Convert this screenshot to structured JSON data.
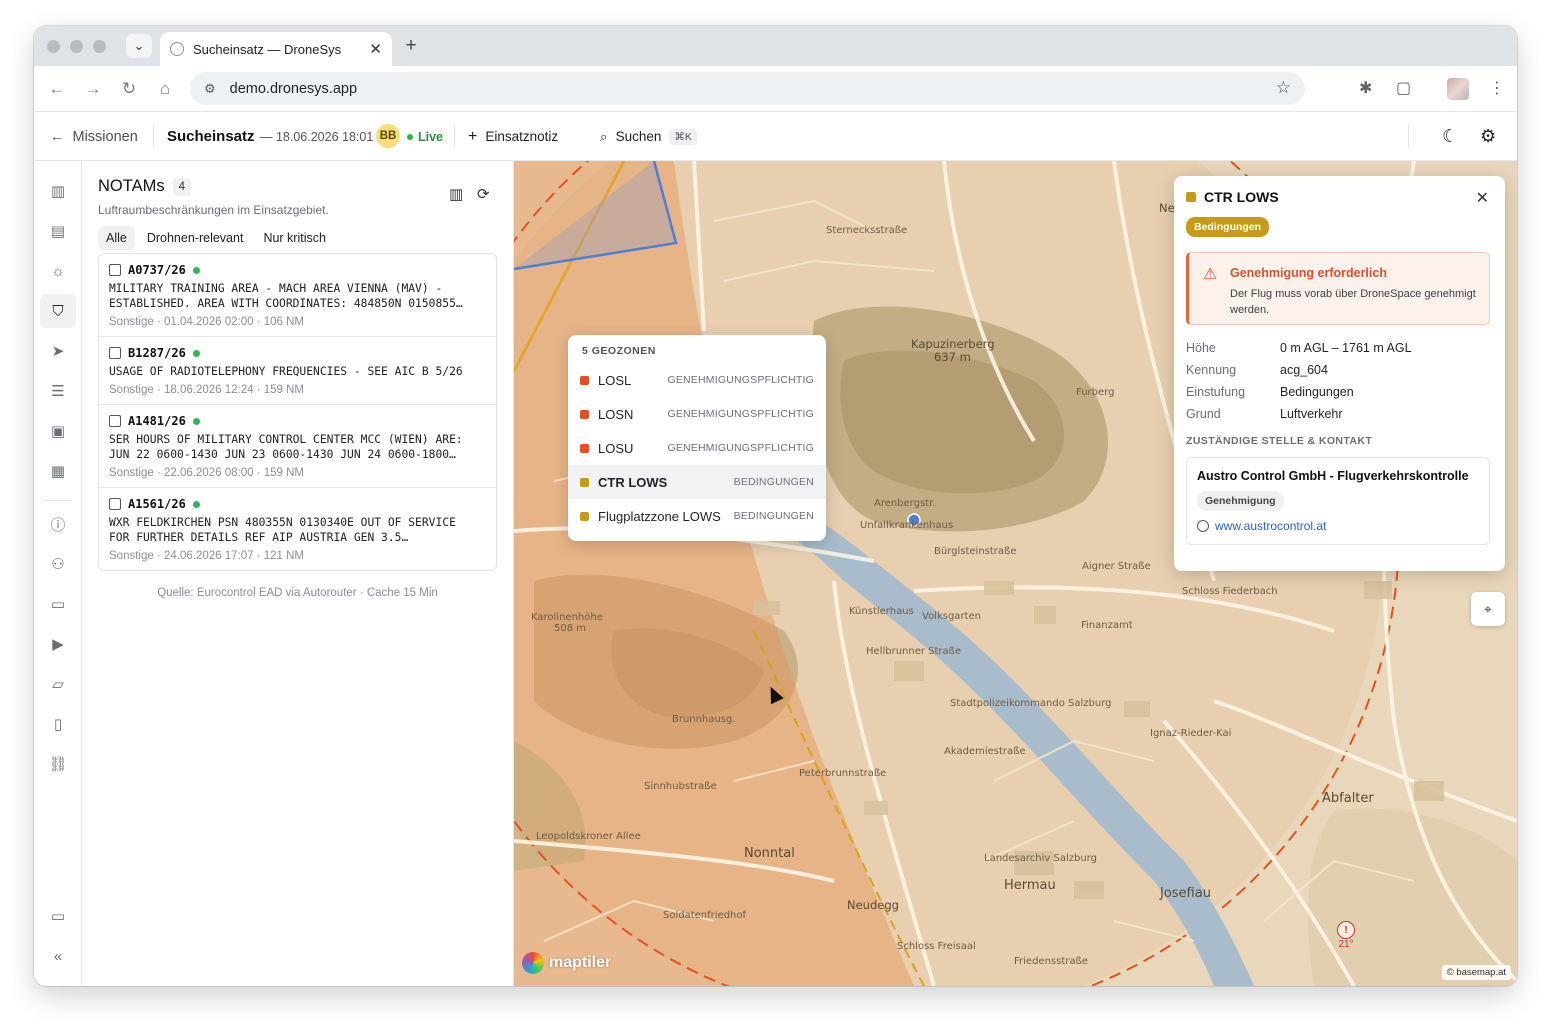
{
  "browser": {
    "tab_title": "Sucheinsatz — DroneSys",
    "url": "demo.dronesys.app",
    "icons": [
      "chevron-down-icon",
      "close-icon",
      "plus-icon",
      "back-icon",
      "forward-icon",
      "reload-icon",
      "home-icon",
      "site-info-icon",
      "star-icon",
      "extension-icon",
      "menu-dots-icon"
    ]
  },
  "header": {
    "back_label": "Missionen",
    "mission": "Sucheinsatz",
    "date": "— 18.06.2026 18:01",
    "user_initials": "BB",
    "live": "Live",
    "note_label": "Einsatznotiz",
    "search_label": "Suchen",
    "search_kbd": "⌘K"
  },
  "notams": {
    "title": "NOTAMs",
    "count": "4",
    "subtitle": "Luftraumbeschränkungen im Einsatzgebiet.",
    "filters": [
      "Alle",
      "Drohnen-relevant",
      "Nur kritisch"
    ],
    "items": [
      {
        "id": "A0737/26",
        "text": "MILITARY TRAINING AREA - MACH AREA VIENNA (MAV) -\nESTABLISHED. AREA WITH COORDINATES: 484850N 0150855…",
        "meta": "Sonstige · 01.04.2026 02:00 · 106 NM"
      },
      {
        "id": "B1287/26",
        "text": "USAGE OF RADIOTELEPHONY FREQUENCIES - SEE AIC B 5/26",
        "meta": "Sonstige · 18.06.2026 12:24 · 159 NM"
      },
      {
        "id": "A1481/26",
        "text": "SER HOURS OF MILITARY CONTROL CENTER MCC (WIEN) ARE:\nJUN 22 0600-1430 JUN 23 0600-1430 JUN 24 0600-1800…",
        "meta": "Sonstige · 22.06.2026 08:00 · 159 NM"
      },
      {
        "id": "A1561/26",
        "text": "WXR FELDKIRCHEN PSN 480355N 0130340E OUT OF SERVICE\nFOR FURTHER DETAILS REF AIP AUSTRIA GEN 3.5…",
        "meta": "Sonstige · 24.06.2026 17:07 · 121 NM"
      }
    ],
    "source": "Quelle: Eurocontrol EAD via Autorouter · Cache 15 Min"
  },
  "geozones": {
    "header": "5 GEOZONEN",
    "items": [
      {
        "name": "LOSL",
        "status": "GENEHMIGUNGSPFLICHTIG",
        "color": "#e0521f"
      },
      {
        "name": "LOSN",
        "status": "GENEHMIGUNGSPFLICHTIG",
        "color": "#e0521f"
      },
      {
        "name": "LOSU",
        "status": "GENEHMIGUNGSPFLICHTIG",
        "color": "#e0521f"
      },
      {
        "name": "CTR LOWS",
        "status": "BEDINGUNGEN",
        "color": "#c69a1b"
      },
      {
        "name": "Flugplatzzone LOWS",
        "status": "BEDINGUNGEN",
        "color": "#c69a1b"
      }
    ]
  },
  "detail": {
    "title": "CTR LOWS",
    "badge": "Bedingungen",
    "alert_title": "Genehmigung erforderlich",
    "alert_body": "Der Flug muss vorab über DroneSpace genehmigt werden.",
    "props": [
      {
        "k": "Höhe",
        "v": "0 m AGL – 1761 m AGL"
      },
      {
        "k": "Kennung",
        "v": "acg_604"
      },
      {
        "k": "Einstufung",
        "v": "Bedingungen"
      },
      {
        "k": "Grund",
        "v": "Luftverkehr"
      }
    ],
    "section": "ZUSTÄNDIGE STELLE & KONTAKT",
    "org": "Austro Control GmbH - Flugverkehrskontrolle",
    "org_chip": "Genehmigung",
    "website": "www.austrocontrol.at"
  },
  "map": {
    "brand": "maptiler",
    "attribution": "© basemap.at",
    "weather_temp": "21°",
    "labels": [
      {
        "t": "Kapuzinerberg",
        "s": "mid"
      },
      {
        "t": "637 m",
        "s": "mid"
      },
      {
        "t": "Nonntal",
        "s": "big"
      },
      {
        "t": "Hermau",
        "s": "big"
      },
      {
        "t": "Josefiau",
        "s": "big"
      },
      {
        "t": "Abfalter",
        "s": "big"
      },
      {
        "t": "Neudegg",
        "s": "mid"
      },
      {
        "t": "Furberg",
        "s": ""
      },
      {
        "t": "Bürglsteinstraße",
        "s": ""
      },
      {
        "t": "Sternecksstraße",
        "s": ""
      },
      {
        "t": "Schloss Freisaal",
        "s": ""
      },
      {
        "t": "Brunnhausg.",
        "s": ""
      },
      {
        "t": "Soldatenfriedhof",
        "s": ""
      },
      {
        "t": "Sinnhubstraße",
        "s": ""
      },
      {
        "t": "Karolinenhöhe",
        "s": ""
      },
      {
        "t": "508 m",
        "s": ""
      },
      {
        "t": "Leopoldskroner Allee",
        "s": ""
      },
      {
        "t": "Volksgarten",
        "s": ""
      },
      {
        "t": "Künstlerhaus",
        "s": ""
      },
      {
        "t": "Akademiestraße",
        "s": ""
      },
      {
        "t": "Aigner Straße",
        "s": ""
      },
      {
        "t": "Finanzamt",
        "s": ""
      },
      {
        "t": "Ignaz-Rieder-Kai",
        "s": ""
      },
      {
        "t": "Peterbrunnstraße",
        "s": ""
      },
      {
        "t": "Unfallkrankenhaus",
        "s": ""
      },
      {
        "t": "Arenbergstr.",
        "s": ""
      },
      {
        "t": "Neu",
        "s": "mid"
      },
      {
        "t": "Schloss Fiederbach",
        "s": ""
      },
      {
        "t": "Landesarchiv Salzburg",
        "s": ""
      },
      {
        "t": "Friedensstraße",
        "s": ""
      },
      {
        "t": "Hellbrunner Straße",
        "s": ""
      },
      {
        "t": "Stadtpolizeikommando Salzburg",
        "s": ""
      }
    ]
  }
}
